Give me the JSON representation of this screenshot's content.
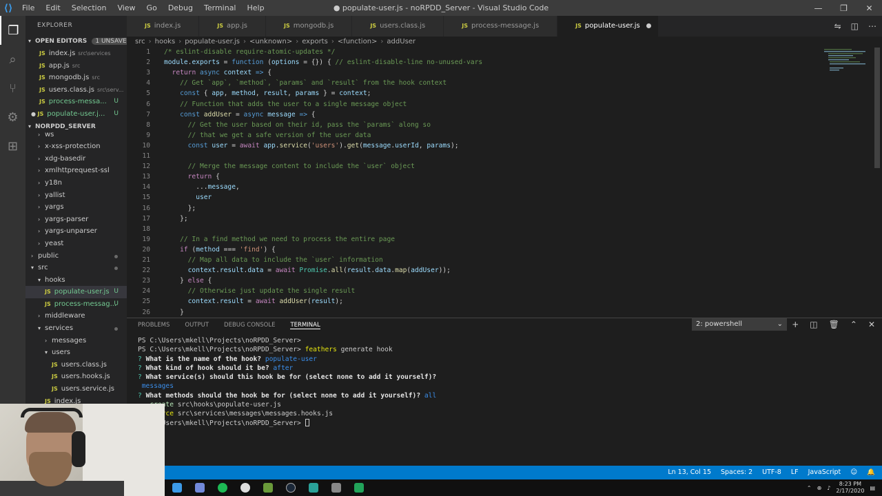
{
  "window": {
    "title": "● populate-user.js - noRPDD_Server - Visual Studio Code",
    "menu": [
      "File",
      "Edit",
      "Selection",
      "View",
      "Go",
      "Debug",
      "Terminal",
      "Help"
    ]
  },
  "sidebar": {
    "title": "EXPLORER",
    "open_editors_label": "OPEN EDITORS",
    "unsaved_badge": "1 UNSAVED",
    "open_editors": [
      {
        "name": "index.js",
        "desc": "src\\services",
        "status": ""
      },
      {
        "name": "app.js",
        "desc": "src",
        "status": ""
      },
      {
        "name": "mongodb.js",
        "desc": "src",
        "status": ""
      },
      {
        "name": "users.class.js",
        "desc": "src\\serv...",
        "status": ""
      },
      {
        "name": "process-messa...",
        "desc": "",
        "status": "U"
      },
      {
        "name": "populate-user.j...",
        "desc": "",
        "status": "U"
      }
    ],
    "project_label": "NORPDD_SERVER",
    "tree": [
      {
        "label": "ws",
        "indent": 1,
        "type": "folder"
      },
      {
        "label": "x-xss-protection",
        "indent": 1,
        "type": "folder"
      },
      {
        "label": "xdg-basedir",
        "indent": 1,
        "type": "folder"
      },
      {
        "label": "xmlhttprequest-ssl",
        "indent": 1,
        "type": "folder"
      },
      {
        "label": "y18n",
        "indent": 1,
        "type": "folder"
      },
      {
        "label": "yallist",
        "indent": 1,
        "type": "folder"
      },
      {
        "label": "yargs",
        "indent": 1,
        "type": "folder"
      },
      {
        "label": "yargs-parser",
        "indent": 1,
        "type": "folder"
      },
      {
        "label": "yargs-unparser",
        "indent": 1,
        "type": "folder"
      },
      {
        "label": "yeast",
        "indent": 1,
        "type": "folder"
      },
      {
        "label": "public",
        "indent": 0,
        "type": "folder"
      },
      {
        "label": "src",
        "indent": 0,
        "type": "open"
      },
      {
        "label": "hooks",
        "indent": 1,
        "type": "open"
      },
      {
        "label": "populate-user.js",
        "indent": 2,
        "type": "file",
        "status": "U"
      },
      {
        "label": "process-messag...",
        "indent": 2,
        "type": "file",
        "status": "U"
      },
      {
        "label": "middleware",
        "indent": 1,
        "type": "folder"
      },
      {
        "label": "services",
        "indent": 1,
        "type": "open"
      },
      {
        "label": "messages",
        "indent": 2,
        "type": "folder"
      },
      {
        "label": "users",
        "indent": 2,
        "type": "open"
      },
      {
        "label": "users.class.js",
        "indent": 3,
        "type": "file",
        "status": ""
      },
      {
        "label": "users.hooks.js",
        "indent": 3,
        "type": "file",
        "status": ""
      },
      {
        "label": "users.service.js",
        "indent": 3,
        "type": "file",
        "status": ""
      },
      {
        "label": "index.js",
        "indent": 2,
        "type": "file",
        "status": ""
      }
    ]
  },
  "tabs": [
    {
      "label": "index.js",
      "active": false
    },
    {
      "label": "app.js",
      "active": false
    },
    {
      "label": "mongodb.js",
      "active": false
    },
    {
      "label": "users.class.js",
      "active": false
    },
    {
      "label": "process-message.js",
      "active": false
    },
    {
      "label": "populate-user.js",
      "active": true
    }
  ],
  "breadcrumb": [
    "src",
    "hooks",
    "populate-user.js",
    "<unknown>",
    "exports",
    "<function>",
    "addUser"
  ],
  "editor": {
    "lines": [
      [
        [
          "c-com",
          "/* eslint-disable require-atomic-updates */"
        ]
      ],
      [
        [
          "c-var",
          "module"
        ],
        [
          "",
          "."
        ],
        [
          "c-var",
          "exports"
        ],
        [
          "",
          " = "
        ],
        [
          "c-kw",
          "function"
        ],
        [
          "",
          " ("
        ],
        [
          "c-var",
          "options"
        ],
        [
          "",
          " = {}) { "
        ],
        [
          "c-com",
          "// eslint-disable-line no-unused-vars"
        ]
      ],
      [
        [
          "",
          "  "
        ],
        [
          "c-ctl",
          "return"
        ],
        [
          "",
          " "
        ],
        [
          "c-kw",
          "async"
        ],
        [
          "",
          " "
        ],
        [
          "c-var",
          "context"
        ],
        [
          "",
          " "
        ],
        [
          "c-kw",
          "=>"
        ],
        [
          "",
          " {"
        ]
      ],
      [
        [
          "",
          "    "
        ],
        [
          "c-com",
          "// Get `app`, `method`, `params` and `result` from the hook context"
        ]
      ],
      [
        [
          "",
          "    "
        ],
        [
          "c-kw",
          "const"
        ],
        [
          "",
          " { "
        ],
        [
          "c-var",
          "app"
        ],
        [
          "",
          ", "
        ],
        [
          "c-var",
          "method"
        ],
        [
          "",
          ", "
        ],
        [
          "c-var",
          "result"
        ],
        [
          "",
          ", "
        ],
        [
          "c-var",
          "params"
        ],
        [
          "",
          " } = "
        ],
        [
          "c-var",
          "context"
        ],
        [
          "",
          ";"
        ]
      ],
      [
        [
          "",
          "    "
        ],
        [
          "c-com",
          "// Function that adds the user to a single message object"
        ]
      ],
      [
        [
          "",
          "    "
        ],
        [
          "c-kw",
          "const"
        ],
        [
          "",
          " "
        ],
        [
          "c-fn",
          "addUser"
        ],
        [
          "",
          " = "
        ],
        [
          "c-kw",
          "async"
        ],
        [
          "",
          " "
        ],
        [
          "c-var",
          "message"
        ],
        [
          "",
          " "
        ],
        [
          "c-kw",
          "=>"
        ],
        [
          "",
          " {"
        ]
      ],
      [
        [
          "",
          "      "
        ],
        [
          "c-com",
          "// Get the user based on their id, pass the `params` along so"
        ]
      ],
      [
        [
          "",
          "      "
        ],
        [
          "c-com",
          "// that we get a safe version of the user data"
        ]
      ],
      [
        [
          "",
          "      "
        ],
        [
          "c-kw",
          "const"
        ],
        [
          "",
          " "
        ],
        [
          "c-var",
          "user"
        ],
        [
          "",
          " = "
        ],
        [
          "c-ctl",
          "await"
        ],
        [
          "",
          " "
        ],
        [
          "c-var",
          "app"
        ],
        [
          "",
          "."
        ],
        [
          "c-fn",
          "service"
        ],
        [
          "",
          "("
        ],
        [
          "c-str",
          "'users'"
        ],
        [
          "",
          ")."
        ],
        [
          "c-fn",
          "get"
        ],
        [
          "",
          "("
        ],
        [
          "c-var",
          "message"
        ],
        [
          "",
          "."
        ],
        [
          "c-var",
          "userId"
        ],
        [
          "",
          ", "
        ],
        [
          "c-var",
          "params"
        ],
        [
          "",
          ");"
        ]
      ],
      [
        [
          "",
          ""
        ]
      ],
      [
        [
          "",
          "      "
        ],
        [
          "c-com",
          "// Merge the message content to include the `user` object"
        ]
      ],
      [
        [
          "",
          "      "
        ],
        [
          "c-ctl",
          "return"
        ],
        [
          "",
          " {"
        ]
      ],
      [
        [
          "",
          "        ..."
        ],
        [
          "c-var",
          "message"
        ],
        [
          "",
          ","
        ]
      ],
      [
        [
          "",
          "        "
        ],
        [
          "c-var",
          "user"
        ]
      ],
      [
        [
          "",
          "      };"
        ]
      ],
      [
        [
          "",
          "    };"
        ]
      ],
      [
        [
          "",
          ""
        ]
      ],
      [
        [
          "",
          "    "
        ],
        [
          "c-com",
          "// In a find method we need to process the entire page"
        ]
      ],
      [
        [
          "",
          "    "
        ],
        [
          "c-ctl",
          "if"
        ],
        [
          "",
          " ("
        ],
        [
          "c-var",
          "method"
        ],
        [
          "",
          " === "
        ],
        [
          "c-str",
          "'find'"
        ],
        [
          "",
          ") {"
        ]
      ],
      [
        [
          "",
          "      "
        ],
        [
          "c-com",
          "// Map all data to include the `user` information"
        ]
      ],
      [
        [
          "",
          "      "
        ],
        [
          "c-var",
          "context"
        ],
        [
          "",
          "."
        ],
        [
          "c-var",
          "result"
        ],
        [
          "",
          "."
        ],
        [
          "c-var",
          "data"
        ],
        [
          "",
          " = "
        ],
        [
          "c-ctl",
          "await"
        ],
        [
          "",
          " "
        ],
        [
          "c-cls",
          "Promise"
        ],
        [
          "",
          "."
        ],
        [
          "c-fn",
          "all"
        ],
        [
          "",
          "("
        ],
        [
          "c-var",
          "result"
        ],
        [
          "",
          "."
        ],
        [
          "c-var",
          "data"
        ],
        [
          "",
          "."
        ],
        [
          "c-fn",
          "map"
        ],
        [
          "",
          "("
        ],
        [
          "c-var",
          "addUser"
        ],
        [
          "",
          "));"
        ]
      ],
      [
        [
          "",
          "    } "
        ],
        [
          "c-ctl",
          "else"
        ],
        [
          "",
          " {"
        ]
      ],
      [
        [
          "",
          "      "
        ],
        [
          "c-com",
          "// Otherwise just update the single result"
        ]
      ],
      [
        [
          "",
          "      "
        ],
        [
          "c-var",
          "context"
        ],
        [
          "",
          "."
        ],
        [
          "c-var",
          "result"
        ],
        [
          "",
          " = "
        ],
        [
          "c-ctl",
          "await"
        ],
        [
          "",
          " "
        ],
        [
          "c-fn",
          "addUser"
        ],
        [
          "",
          "("
        ],
        [
          "c-var",
          "result"
        ],
        [
          "",
          ");"
        ]
      ],
      [
        [
          "",
          "    }"
        ]
      ]
    ]
  },
  "panel": {
    "tabs": [
      "PROBLEMS",
      "OUTPUT",
      "DEBUG CONSOLE",
      "TERMINAL"
    ],
    "active_tab": "TERMINAL",
    "terminal_select": "2: powershell",
    "terminal": {
      "l1": "PS C:\\Users\\mkell\\Projects\\noRPDD_Server>",
      "l2_prompt": "PS C:\\Users\\mkell\\Projects\\noRPDD_Server> ",
      "l2_cmd": "feathers",
      "l2_rest": " generate hook",
      "q1": "What is the name of the hook?",
      "a1": "populate-user",
      "q2": "What kind of hook should it be?",
      "a2": "after",
      "q3": "What service(s) should this hook be for (select none to add it yourself)?",
      "a3": "messages",
      "q4": "What methods should the hook be for (select none to add it yourself)?",
      "a4": "all",
      "c1_kw": "create",
      "c1": "src\\hooks\\populate-user.js",
      "c2_kw": "force",
      "c2": "src\\services\\messages\\messages.hooks.js",
      "last": "PS C:\\Users\\mkell\\Projects\\noRPDD_Server> "
    }
  },
  "status": {
    "position": "Ln 13, Col 15",
    "spaces": "Spaces: 2",
    "encoding": "UTF-8",
    "eol": "LF",
    "language": "JavaScript"
  },
  "taskbar": {
    "time": "8:23 PM",
    "date": "2/17/2020"
  }
}
